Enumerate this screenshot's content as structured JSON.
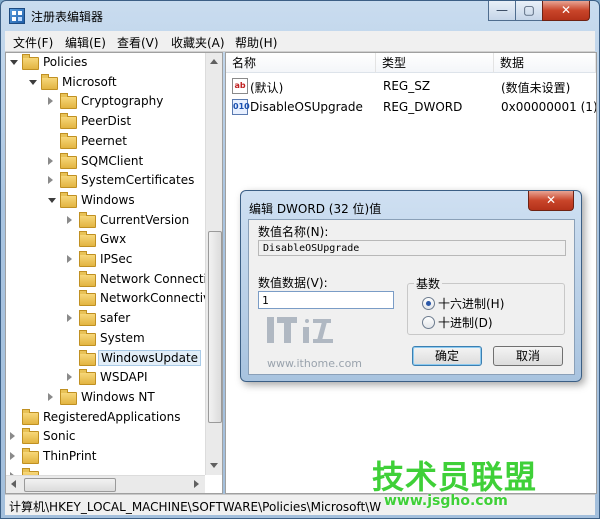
{
  "window": {
    "title": "注册表编辑器",
    "minimize_glyph": "—",
    "maximize_glyph": "▢",
    "close_glyph": "✕"
  },
  "menu": [
    "文件(F)",
    "编辑(E)",
    "查看(V)",
    "收藏夹(A)",
    "帮助(H)"
  ],
  "tree": [
    {
      "label": "Policies",
      "level": 1,
      "state": "open"
    },
    {
      "label": "Microsoft",
      "level": 2,
      "state": "open"
    },
    {
      "label": "Cryptography",
      "level": 3,
      "state": "closed"
    },
    {
      "label": "PeerDist",
      "level": 3,
      "state": "none"
    },
    {
      "label": "Peernet",
      "level": 3,
      "state": "none"
    },
    {
      "label": "SQMClient",
      "level": 3,
      "state": "closed"
    },
    {
      "label": "SystemCertificates",
      "level": 3,
      "state": "closed"
    },
    {
      "label": "Windows",
      "level": 3,
      "state": "open"
    },
    {
      "label": "CurrentVersion",
      "level": 4,
      "state": "closed"
    },
    {
      "label": "Gwx",
      "level": 4,
      "state": "none"
    },
    {
      "label": "IPSec",
      "level": 4,
      "state": "closed"
    },
    {
      "label": "Network Connecti",
      "level": 4,
      "state": "none"
    },
    {
      "label": "NetworkConnectiv",
      "level": 4,
      "state": "none"
    },
    {
      "label": "safer",
      "level": 4,
      "state": "closed"
    },
    {
      "label": "System",
      "level": 4,
      "state": "none"
    },
    {
      "label": "WindowsUpdate",
      "level": 4,
      "state": "none",
      "selected": true
    },
    {
      "label": "WSDAPI",
      "level": 4,
      "state": "closed"
    },
    {
      "label": "Windows NT",
      "level": 3,
      "state": "closed"
    },
    {
      "label": "RegisteredApplications",
      "level": 1,
      "state": "none"
    },
    {
      "label": "Sonic",
      "level": 1,
      "state": "closed"
    },
    {
      "label": "ThinPrint",
      "level": 1,
      "state": "closed"
    },
    {
      "label": "",
      "level": 1,
      "state": "closed"
    }
  ],
  "list": {
    "columns": [
      "名称",
      "类型",
      "数据"
    ],
    "rows": [
      {
        "icon": "ab",
        "icon_kind": "string-value-icon",
        "name": "(默认)",
        "type": "REG_SZ",
        "data": "(数值未设置)"
      },
      {
        "icon": "010",
        "icon_kind": "dword-value-icon",
        "name": "DisableOSUpgrade",
        "type": "REG_DWORD",
        "data": "0x00000001 (1)"
      }
    ]
  },
  "status": {
    "path": "计算机\\HKEY_LOCAL_MACHINE\\SOFTWARE\\Policies\\Microsoft\\W"
  },
  "dialog": {
    "title": "编辑 DWORD (32 位)值",
    "close_glyph": "✕",
    "value_name_label": "数值名称(N):",
    "value_name": "DisableOSUpgrade",
    "value_data_label": "数值数据(V):",
    "value_data": "1",
    "base_label": "基数",
    "hex_label": "十六进制(H)",
    "dec_label": "十进制(D)",
    "selected_base": "hex",
    "ok_label": "确定",
    "cancel_label": "取消"
  },
  "watermarks": {
    "ithome_logo": "IT之家",
    "ithome_url": "www.ithome.com",
    "site_name": "技术员联盟",
    "site_url": "www.jsgho.com"
  },
  "colors": {
    "title_gradient_top": "#c9dcef",
    "close_red": "#c9452a",
    "selection": "#e2eef8",
    "watermark_green": "#3fd038"
  }
}
